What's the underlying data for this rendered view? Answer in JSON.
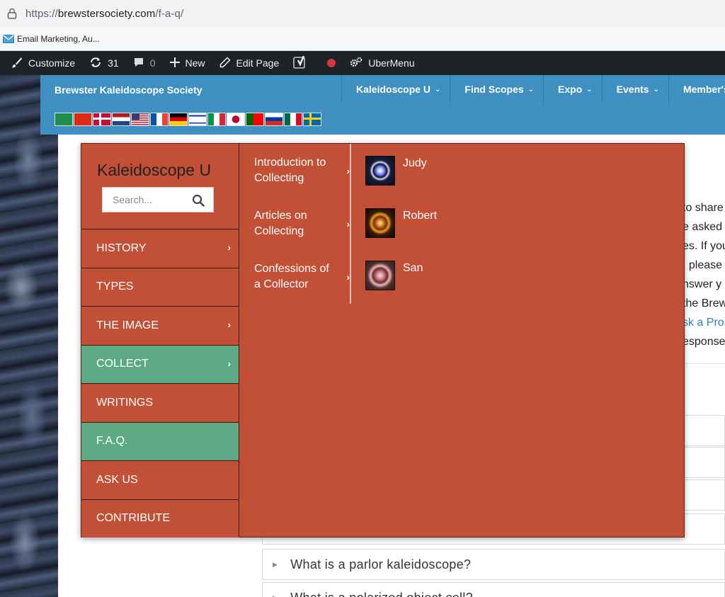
{
  "browser": {
    "url_scheme": "https://",
    "url_host": "brewstersociety.com",
    "url_path": "/f-a-q/",
    "bookmark_label": "Email Marketing, Au..."
  },
  "adminbar": {
    "customize": "Customize",
    "updates_count": "31",
    "comments_count": "0",
    "new_label": "New",
    "edit_page": "Edit Page",
    "ubermenu": "UberMenu"
  },
  "site": {
    "brand": "Brewster Kaleidoscope Society",
    "nav": [
      "Kaleidoscope U",
      "Find Scopes",
      "Expo",
      "Events",
      "Member's A"
    ],
    "flags": [
      "arabic-flag",
      "china-flag",
      "denmark-flag",
      "netherlands-flag",
      "usa-flag",
      "france-flag",
      "germany-flag",
      "israel-flag",
      "italy-flag",
      "japan-flag",
      "portugal-flag",
      "russia-flag",
      "mexico-flag",
      "sweden-flag"
    ]
  },
  "megamenu": {
    "heading": "Kaleidoscope U",
    "search_placeholder": "Search...",
    "categories": [
      {
        "label": "HISTORY",
        "has_arrow": true,
        "active": false
      },
      {
        "label": "TYPES",
        "has_arrow": false,
        "active": false
      },
      {
        "label": "THE IMAGE",
        "has_arrow": true,
        "active": false
      },
      {
        "label": "COLLECT",
        "has_arrow": true,
        "active": true
      },
      {
        "label": "WRITINGS",
        "has_arrow": false,
        "active": false
      },
      {
        "label": "F.A.Q.",
        "has_arrow": false,
        "active": true
      },
      {
        "label": "ASK US",
        "has_arrow": false,
        "active": false
      },
      {
        "label": "CONTRIBUTE",
        "has_arrow": false,
        "active": false
      }
    ],
    "submenu": [
      {
        "label": "Introduction to Collecting"
      },
      {
        "label": "Articles on Collecting"
      },
      {
        "label": "Confessions of a Collector"
      }
    ],
    "collectors": [
      {
        "name": "Judy"
      },
      {
        "name": "Robert"
      },
      {
        "name": "San"
      }
    ]
  },
  "page": {
    "body_lines": [
      "to share",
      "e asked a",
      "es. If you",
      ", please",
      "nswer y",
      "the Brew",
      "sk a Pro",
      "esponse"
    ],
    "faq_items": [
      "What is a parlor kaleidoscope?",
      "What is a polarized object cell?"
    ]
  },
  "colors": {
    "menu_bg": "#c15037",
    "menu_active": "#5ea985",
    "header_blue": "#3f8fc0",
    "adminbar_bg": "#1d2327"
  }
}
